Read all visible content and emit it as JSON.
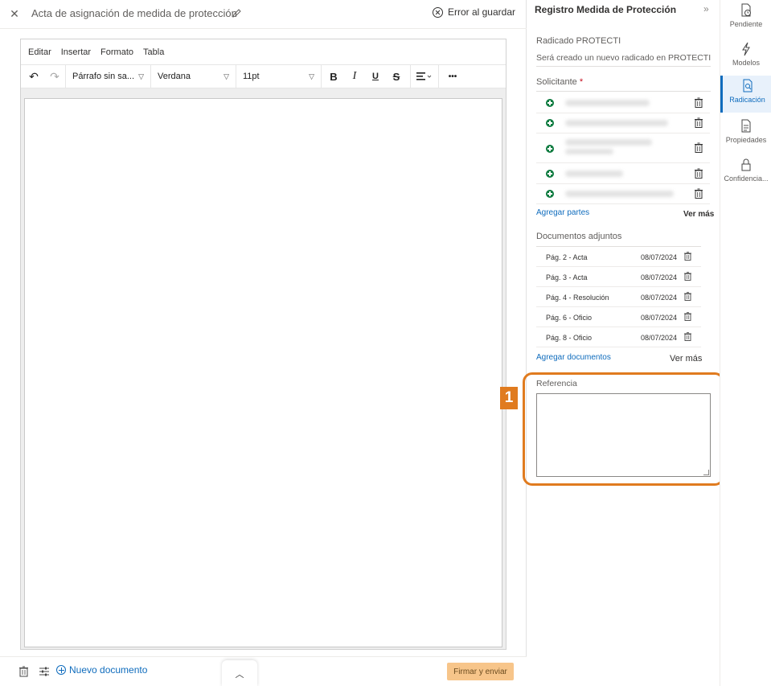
{
  "editor": {
    "title": "Acta de asignación de medida de protección",
    "status": "Error al guardar",
    "menu": [
      "Editar",
      "Insertar",
      "Formato",
      "Tabla"
    ],
    "toolbar": {
      "block_format": "Párrafo sin sa...",
      "font_family": "Verdana",
      "font_size": "11pt",
      "bold": "B",
      "italic": "I",
      "underline": "U",
      "strike": "S",
      "more": "•••"
    }
  },
  "footer": {
    "new_doc": "Nuevo documento",
    "submit": "Firmar y enviar"
  },
  "panel": {
    "title": "Registro Medida de Protección",
    "radicado_label": "Radicado PROTECTI",
    "radicado_text": "Será creado un nuevo radicado en PROTECTI",
    "solicitante_label": "Solicitante",
    "required_mark": "*",
    "add_parties": "Agregar partes",
    "see_more_parties": "Ver más",
    "attachments_label": "Documentos adjuntos",
    "documents": [
      {
        "name": "Pág. 2 - Acta",
        "date": "08/07/2024"
      },
      {
        "name": "Pág. 3 - Acta",
        "date": "08/07/2024"
      },
      {
        "name": "Pág. 4 - Resolución",
        "date": "08/07/2024"
      },
      {
        "name": "Pág. 6 - Oficio",
        "date": "08/07/2024"
      },
      {
        "name": "Pág. 8 - Oficio",
        "date": "08/07/2024"
      }
    ],
    "add_documents": "Agregar documentos",
    "see_more_docs": "Ver más",
    "reference_label": "Referencia",
    "reference_value": ""
  },
  "annotation": {
    "step": "1",
    "color": "#e07b1f"
  },
  "rail": {
    "items": [
      {
        "label": "Pendiente",
        "icon": "pending-icon"
      },
      {
        "label": "Modelos",
        "icon": "lightning-icon"
      },
      {
        "label": "Radicación",
        "icon": "filing-icon",
        "active": true
      },
      {
        "label": "Propiedades",
        "icon": "properties-icon"
      },
      {
        "label": "Confidencia...",
        "icon": "lock-icon"
      }
    ]
  },
  "colors": {
    "accent": "#0f6cbd",
    "submit_bg": "#f7c58a",
    "add_green": "#107c41"
  }
}
